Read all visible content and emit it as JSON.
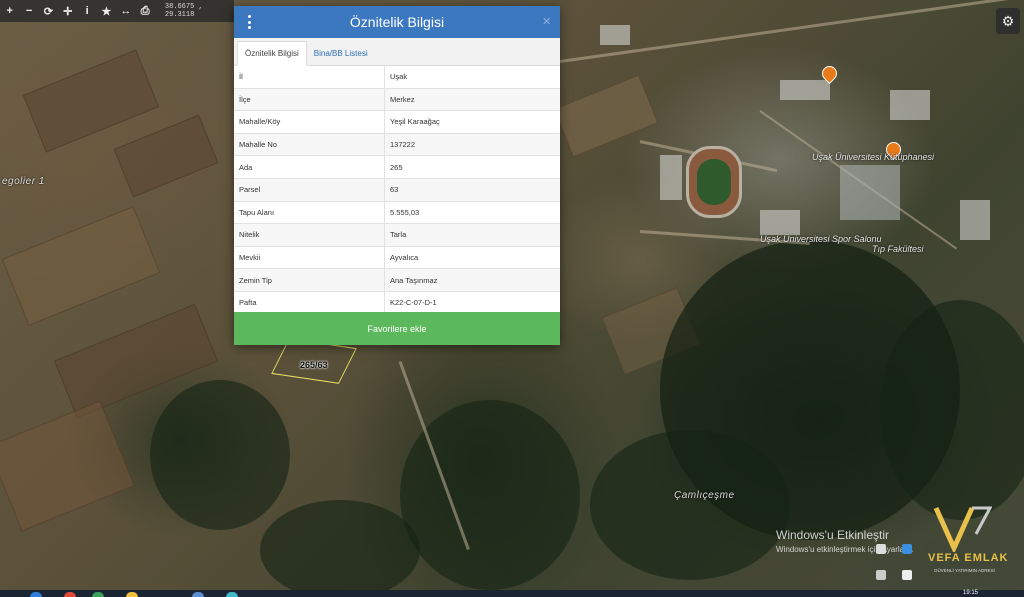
{
  "toolbar": {
    "tools": [
      {
        "name": "zoom-in-icon",
        "glyph": "+"
      },
      {
        "name": "zoom-out-icon",
        "glyph": "−"
      },
      {
        "name": "refresh-icon",
        "glyph": "⟳"
      },
      {
        "name": "locate-icon",
        "glyph": "✛"
      },
      {
        "name": "info-icon",
        "glyph": "i"
      },
      {
        "name": "favorite-star-icon",
        "glyph": "★"
      },
      {
        "name": "measure-icon",
        "glyph": "↔"
      },
      {
        "name": "print-icon",
        "glyph": "⎙"
      }
    ],
    "coordinates": "38.6675 , 29.3118"
  },
  "settings_icon": "gear-icon",
  "dialog": {
    "title": "Öznitelik Bilgisi",
    "tabs": [
      "Öznitelik Bilgisi",
      "Bina/BB Listesi"
    ],
    "attributes": [
      {
        "key": "İl",
        "value": "Uşak"
      },
      {
        "key": "İlçe",
        "value": "Merkez"
      },
      {
        "key": "Mahalle/Köy",
        "value": "Yeşil Karaağaç"
      },
      {
        "key": "Mahalle No",
        "value": "137222"
      },
      {
        "key": "Ada",
        "value": "265"
      },
      {
        "key": "Parsel",
        "value": "63"
      },
      {
        "key": "Tapu Alanı",
        "value": "5.555,03"
      },
      {
        "key": "Nitelik",
        "value": "Tarla"
      },
      {
        "key": "Mevkii",
        "value": "Ayvalıca"
      },
      {
        "key": "Zemin Tip",
        "value": "Ana Taşınmaz"
      },
      {
        "key": "Pafta",
        "value": "K22-C-07-D-1"
      }
    ],
    "favorite_button": "Favorilere ekle"
  },
  "map": {
    "parcel_label": "265/63",
    "labels": [
      "Uşak Üniversitesi Kütüphanesi",
      "Uşak Üniversitesi Spor Salonu",
      "Tıp Fakültesi",
      "Çamlıçeşme",
      "egolier 1"
    ]
  },
  "watermark": {
    "title": "Windows'u Etkinleştir",
    "subtitle": "Windows'u etkinleştirmek için Ayarlar'a"
  },
  "logo": {
    "name": "VEFA EMLAK",
    "tagline": "GÜVENLİ YATIRIMIN ADRESİ"
  },
  "taskbar": {
    "time": "19:15"
  }
}
